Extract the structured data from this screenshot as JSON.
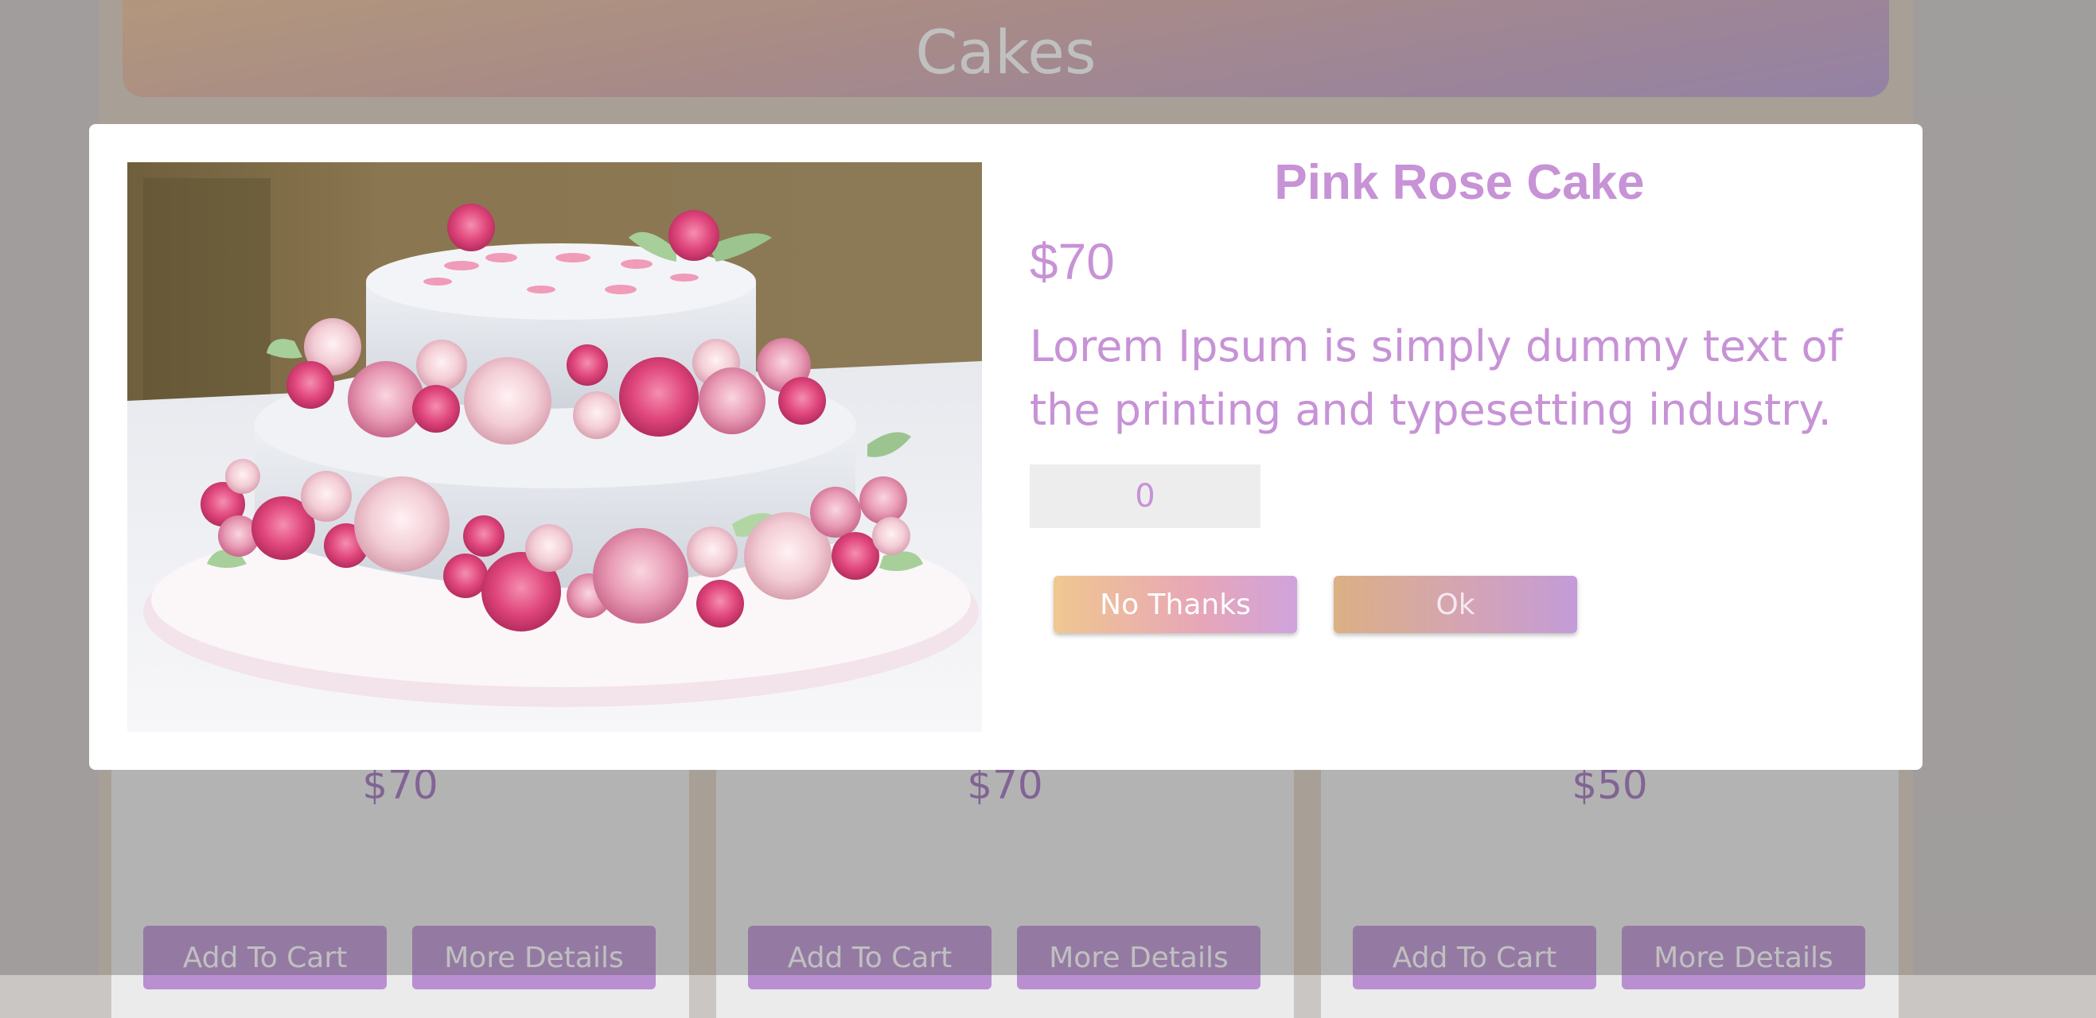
{
  "page": {
    "header_title": "Cakes",
    "cards": [
      {
        "price": "$70",
        "add_label": "Add To Cart",
        "details_label": "More Details"
      },
      {
        "price": "$70",
        "add_label": "Add To Cart",
        "details_label": "More Details"
      },
      {
        "price": "$50",
        "add_label": "Add To Cart",
        "details_label": "More Details"
      }
    ]
  },
  "modal": {
    "title": "Pink Rose Cake",
    "price": "$70",
    "description": "Lorem Ipsum is simply dummy text of the printing and typesetting industry.",
    "quantity": "0",
    "no_thanks_label": "No Thanks",
    "ok_label": "Ok"
  },
  "colors": {
    "accent": "#c792d6",
    "header_gradient_start": "#ecc08f",
    "header_gradient_end": "#b89ad4",
    "card_button": "#b98fd1"
  }
}
